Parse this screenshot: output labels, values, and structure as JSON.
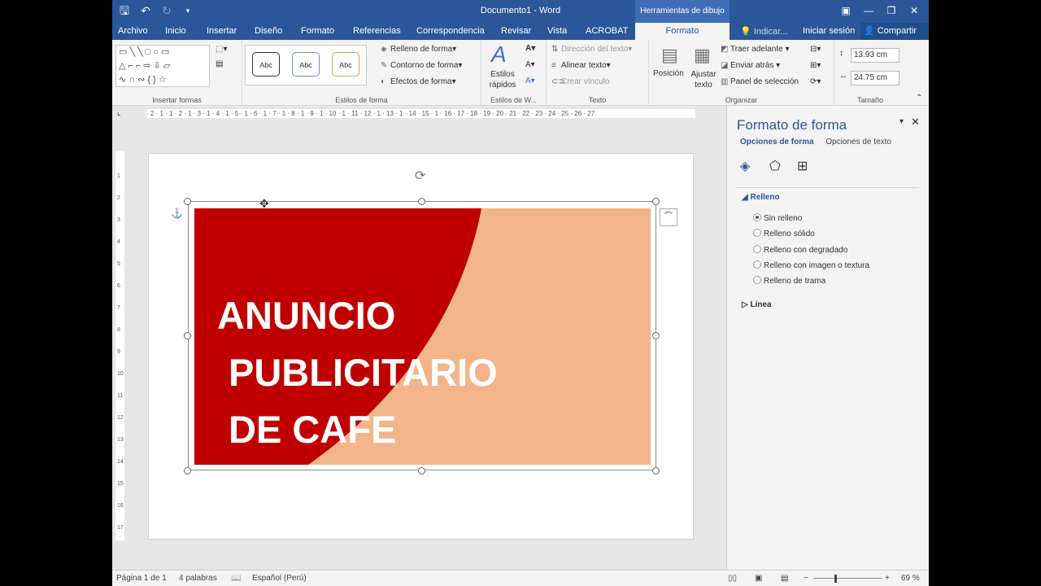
{
  "window": {
    "title": "Documento1 - Word",
    "context_tab_group": "Herramientas de dibujo"
  },
  "tabs": [
    "Archivo",
    "Inicio",
    "Insertar",
    "Diseño",
    "Formato",
    "Referencias",
    "Correspondencia",
    "Revisar",
    "Vista",
    "ACROBAT",
    "Formato"
  ],
  "active_tab": "Formato",
  "tell_me": "Indicar...",
  "account": {
    "signin": "Iniciar sesión",
    "share": "Compartir"
  },
  "ribbon": {
    "groups": {
      "insert_shapes": "Insertar formas",
      "shape_styles": "Estilos de forma",
      "wordart": "Estilos de W...",
      "text": "Texto",
      "arrange": "Organizar",
      "size": "Tamaño"
    },
    "style_thumbs": [
      "Abc",
      "Abc",
      "Abc"
    ],
    "fill": "Relleno de forma",
    "outline": "Contorno de forma",
    "effects": "Efectos de forma",
    "quick_styles": "Estilos rápidos",
    "text_direction": "Dirección del texto",
    "align_text": "Alinear texto",
    "create_link": "Crear vínculo",
    "position": "Posición",
    "wrap_text": "Ajustar texto",
    "bring_forward": "Traer adelante",
    "send_backward": "Enviar atrás",
    "selection_pane": "Panel de selección",
    "height": "13.93 cm",
    "width": "24.75 cm"
  },
  "ruler": {
    "h": "· 2 · 1 · 1 · 2 · 1 · 3 · 1 · 4 · 1 · 5 · 1 · 6 · 1 · 7 · 1 · 8 · 1 · 9 · 1 · 10 · 1 · 11 · 12 · 1 · 13 · 1 · 14 · 15 · 1 · 16 · 17 · 18 · 19 · 20 · 21 · 22 · 23 · 24 · 25 · 26 · 27"
  },
  "document": {
    "ad_lines": [
      "ANUNCIO",
      "PUBLICITARIO",
      "DE CAFE"
    ]
  },
  "pane": {
    "title": "Formato de forma",
    "tab_shape": "Opciones de forma",
    "tab_text": "Opciones de texto",
    "section_fill": "Relleno",
    "fill_options": [
      "Sin relleno",
      "Relleno sólido",
      "Relleno con degradado",
      "Relleno con imagen o textura",
      "Relleno de trama"
    ],
    "selected_fill": 0,
    "section_line": "Línea"
  },
  "status": {
    "page": "Página 1 de 1",
    "words": "4 palabras",
    "language": "Español (Perú)",
    "zoom": "69 %"
  },
  "colors": {
    "accent": "#2b579a",
    "banner_red": "#c00000",
    "banner_peach": "#f2b589"
  }
}
